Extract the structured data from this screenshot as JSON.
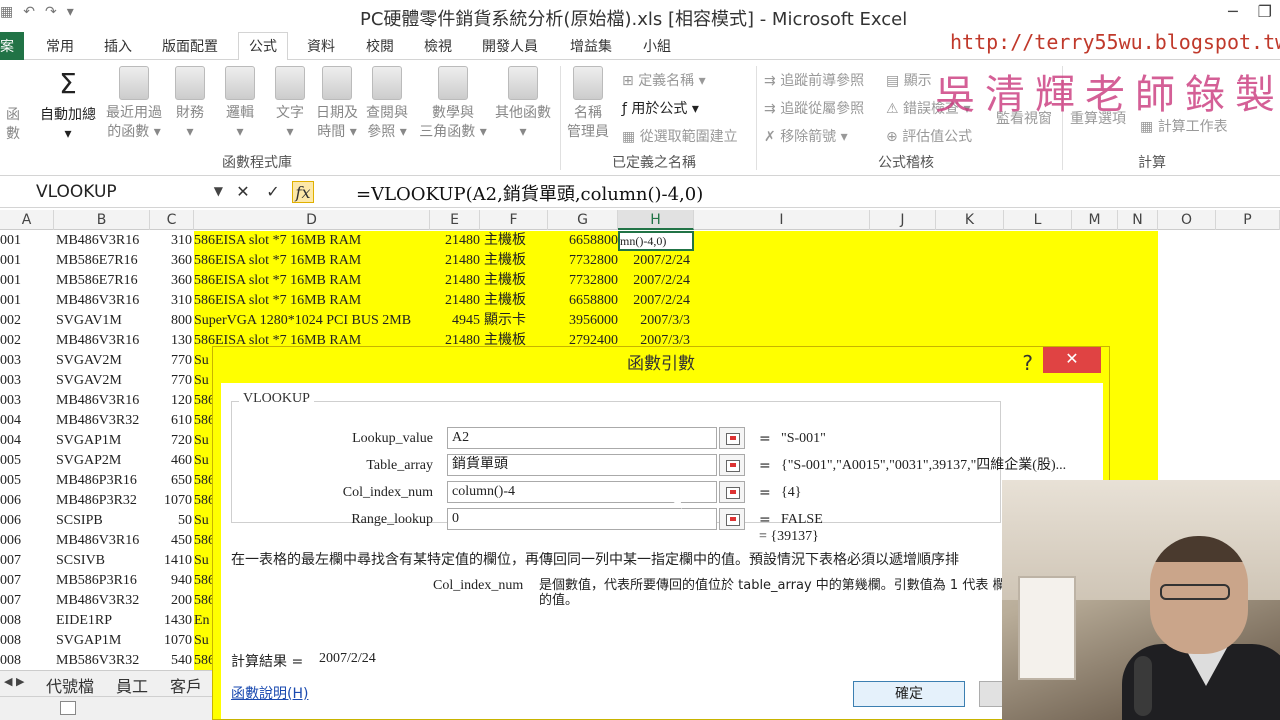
{
  "window": {
    "title": "PC硬體零件銷貨系統分析(原始檔).xls  [相容模式] - Microsoft Excel",
    "controls": [
      "─",
      "❐"
    ]
  },
  "overlay": {
    "blog_url": "http://terry55wu.blogspot.tw",
    "watermark": "吳清輝老師錄製"
  },
  "qat": [
    "▦",
    "↶",
    "↷",
    "▾"
  ],
  "ribbon_tabs": [
    {
      "label": "案"
    },
    {
      "label": "常用"
    },
    {
      "label": "插入"
    },
    {
      "label": "版面配置"
    },
    {
      "label": "公式",
      "active": true
    },
    {
      "label": "資料"
    },
    {
      "label": "校閱"
    },
    {
      "label": "檢視"
    },
    {
      "label": "開發人員"
    },
    {
      "label": "增益集"
    },
    {
      "label": "小組"
    }
  ],
  "ribbon": {
    "function_library": {
      "insert_func": "函數",
      "autosum": {
        "icon": "Σ",
        "line1": "自動加總",
        "line2": "▾"
      },
      "recent": {
        "line1": "最近用過",
        "line2": "的函數 ▾"
      },
      "financial": {
        "line1": "財務",
        "line2": "▾"
      },
      "logical": {
        "line1": "邏輯",
        "line2": "▾"
      },
      "text": {
        "line1": "文字",
        "line2": "▾"
      },
      "datetime": {
        "line1": "日期及",
        "line2": "時間 ▾"
      },
      "lookup": {
        "line1": "查閱與",
        "line2": "參照 ▾"
      },
      "math": {
        "line1": "數學與",
        "line2": "三角函數 ▾"
      },
      "more": {
        "line1": "其他函數",
        "line2": "▾"
      },
      "group_label": "函數程式庫"
    },
    "defined_names": {
      "name_manager": {
        "line1": "名稱",
        "line2": "管理員"
      },
      "define_name": "定義名稱 ▾",
      "use_in_formula": "用於公式 ▾",
      "create_from_selection": "從選取範圍建立",
      "group_label": "已定義之名稱"
    },
    "formula_auditing": {
      "trace_precedents": "追蹤前導參照",
      "trace_dependents": "追蹤從屬參照",
      "remove_arrows": "移除箭號 ▾",
      "show_formulas": "顯示",
      "error_checking": "錯誤檢查 ▾",
      "evaluate_formula": "評估值公式",
      "watch_window": "監看視窗",
      "group_label": "公式稽核"
    },
    "calculation": {
      "options": "重算選項",
      "calc_sheet": "計算工作表",
      "group_label": "計算"
    }
  },
  "formula_bar": {
    "name_box": "VLOOKUP",
    "cancel": "✕",
    "enter": "✓",
    "fx": "fx",
    "formula": "=VLOOKUP(A2,銷貨單頭,column()-4,0)"
  },
  "columns": [
    "A",
    "B",
    "C",
    "D",
    "E",
    "F",
    "G",
    "H",
    "I",
    "J",
    "K",
    "L",
    "M",
    "N",
    "O",
    "P"
  ],
  "rows": [
    {
      "a": "001",
      "b": "MB486V3R16",
      "c": "310",
      "d": "586EISA slot *7 16MB RAM",
      "e": "21480",
      "f": "主機板",
      "g": "6658800",
      "h": "mn()-4,0)"
    },
    {
      "a": "001",
      "b": "MB586E7R16",
      "c": "360",
      "d": "586EISA slot *7 16MB RAM",
      "e": "21480",
      "f": "主機板",
      "g": "7732800",
      "h": "2007/2/24"
    },
    {
      "a": "001",
      "b": "MB586E7R16",
      "c": "360",
      "d": "586EISA slot *7 16MB RAM",
      "e": "21480",
      "f": "主機板",
      "g": "7732800",
      "h": "2007/2/24"
    },
    {
      "a": "001",
      "b": "MB486V3R16",
      "c": "310",
      "d": "586EISA slot *7 16MB RAM",
      "e": "21480",
      "f": "主機板",
      "g": "6658800",
      "h": "2007/2/24"
    },
    {
      "a": "002",
      "b": "SVGAV1M",
      "c": "800",
      "d": "SuperVGA 1280*1024 PCI BUS 2MB",
      "e": "4945",
      "f": "顯示卡",
      "g": "3956000",
      "h": "2007/3/3"
    },
    {
      "a": "002",
      "b": "MB486V3R16",
      "c": "130",
      "d": "586EISA slot *7 16MB RAM",
      "e": "21480",
      "f": "主機板",
      "g": "2792400",
      "h": "2007/3/3"
    },
    {
      "a": "003",
      "b": "SVGAV2M",
      "c": "770",
      "d": "Su",
      "e": "",
      "f": "",
      "g": "",
      "h": ""
    },
    {
      "a": "003",
      "b": "SVGAV2M",
      "c": "770",
      "d": "Su",
      "e": "",
      "f": "",
      "g": "",
      "h": ""
    },
    {
      "a": "003",
      "b": "MB486V3R16",
      "c": "120",
      "d": "586",
      "e": "",
      "f": "",
      "g": "",
      "h": ""
    },
    {
      "a": "004",
      "b": "MB486V3R32",
      "c": "610",
      "d": "586",
      "e": "",
      "f": "",
      "g": "",
      "h": ""
    },
    {
      "a": "004",
      "b": "SVGAP1M",
      "c": "720",
      "d": "Su",
      "e": "",
      "f": "",
      "g": "",
      "h": ""
    },
    {
      "a": "005",
      "b": "SVGAP2M",
      "c": "460",
      "d": "Su",
      "e": "",
      "f": "",
      "g": "",
      "h": ""
    },
    {
      "a": "005",
      "b": "MB486P3R16",
      "c": "650",
      "d": "586",
      "e": "",
      "f": "",
      "g": "",
      "h": ""
    },
    {
      "a": "006",
      "b": "MB486P3R32",
      "c": "1070",
      "d": "586",
      "e": "",
      "f": "",
      "g": "",
      "h": ""
    },
    {
      "a": "006",
      "b": "SCSIPB",
      "c": "50",
      "d": "Su",
      "e": "",
      "f": "",
      "g": "",
      "h": ""
    },
    {
      "a": "006",
      "b": "MB486V3R16",
      "c": "450",
      "d": "586",
      "e": "",
      "f": "",
      "g": "",
      "h": ""
    },
    {
      "a": "007",
      "b": "SCSIVB",
      "c": "1410",
      "d": "Su",
      "e": "",
      "f": "",
      "g": "",
      "h": ""
    },
    {
      "a": "007",
      "b": "MB586P3R16",
      "c": "940",
      "d": "586",
      "e": "",
      "f": "",
      "g": "",
      "h": ""
    },
    {
      "a": "007",
      "b": "MB486V3R32",
      "c": "200",
      "d": "586",
      "e": "",
      "f": "",
      "g": "",
      "h": ""
    },
    {
      "a": "008",
      "b": "EIDE1RP",
      "c": "1430",
      "d": "En",
      "e": "",
      "f": "",
      "g": "",
      "h": ""
    },
    {
      "a": "008",
      "b": "SVGAP1M",
      "c": "1070",
      "d": "Su",
      "e": "",
      "f": "",
      "g": "",
      "h": ""
    },
    {
      "a": "008",
      "b": "MB586V3R32",
      "c": "540",
      "d": "586",
      "e": "",
      "f": "",
      "g": "",
      "h": ""
    }
  ],
  "sheet_tabs": {
    "nav": "◀ ▶",
    "tabs": [
      "代號檔",
      "員工",
      "客戶"
    ]
  },
  "dialog": {
    "title": "函數引數",
    "help": "?",
    "close": "✕",
    "function_name": "VLOOKUP",
    "args": [
      {
        "label": "Lookup_value",
        "value": "A2",
        "result": "\"S-001\""
      },
      {
        "label": "Table_array",
        "value": "銷貨單頭",
        "result": "{\"S-001\",\"A0015\",\"0031\",39137,\"四維企業(股)..."
      },
      {
        "label": "Col_index_num",
        "value": "column()-4",
        "result": "{4}"
      },
      {
        "label": "Range_lookup",
        "value": "0",
        "result": "FALSE"
      }
    ],
    "eq": "=",
    "overall_result": "=  {39137}",
    "description": "在一表格的最左欄中尋找含有某特定值的欄位，再傳回同一列中某一指定欄中的值。預設情況下表格必須以遞增順序排",
    "param_name": "Col_index_num",
    "param_desc": "是個數值，代表所要傳回的值位於 table_array 中的第幾欄。引數值為 1 代表 欄的值。",
    "calc_result_label": "計算結果 =",
    "calc_result_value": "2007/2/24",
    "help_link": "函數說明(H)",
    "ok": "確定",
    "cancel": ""
  },
  "colors": {
    "excel_green": "#217346",
    "highlight_yellow": "#ffff00",
    "close_red": "#e04343"
  }
}
